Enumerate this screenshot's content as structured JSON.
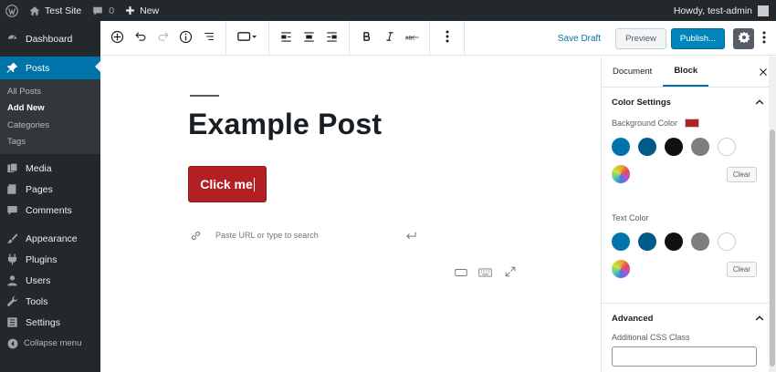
{
  "adminbar": {
    "site_name": "Test Site",
    "comments_count": "0",
    "new_label": "New",
    "howdy": "Howdy, test-admin"
  },
  "sidebar": {
    "items": [
      {
        "label": "Dashboard"
      },
      {
        "label": "Posts"
      },
      {
        "label": "Media"
      },
      {
        "label": "Pages"
      },
      {
        "label": "Comments"
      },
      {
        "label": "Appearance"
      },
      {
        "label": "Plugins"
      },
      {
        "label": "Users"
      },
      {
        "label": "Tools"
      },
      {
        "label": "Settings"
      }
    ],
    "submenu": [
      {
        "label": "All Posts"
      },
      {
        "label": "Add New"
      },
      {
        "label": "Categories"
      },
      {
        "label": "Tags"
      }
    ],
    "collapse_label": "Collapse menu"
  },
  "toolbar": {
    "save_draft": "Save Draft",
    "preview": "Preview",
    "publish": "Publish..."
  },
  "editor": {
    "title": "Example Post",
    "button_text": "Click me",
    "url_placeholder": "Paste URL or type to search"
  },
  "inspector": {
    "tabs": [
      {
        "label": "Document"
      },
      {
        "label": "Block"
      }
    ],
    "color_settings": "Color Settings",
    "background_color": "Background Color",
    "text_color": "Text Color",
    "clear": "Clear",
    "advanced": "Advanced",
    "css_class_label": "Additional CSS Class",
    "colors": {
      "selected_background": "#b32024",
      "palette": [
        "#0073aa",
        "#005a87",
        "#111111",
        "#7e7e7e",
        "#ffffff"
      ]
    }
  }
}
